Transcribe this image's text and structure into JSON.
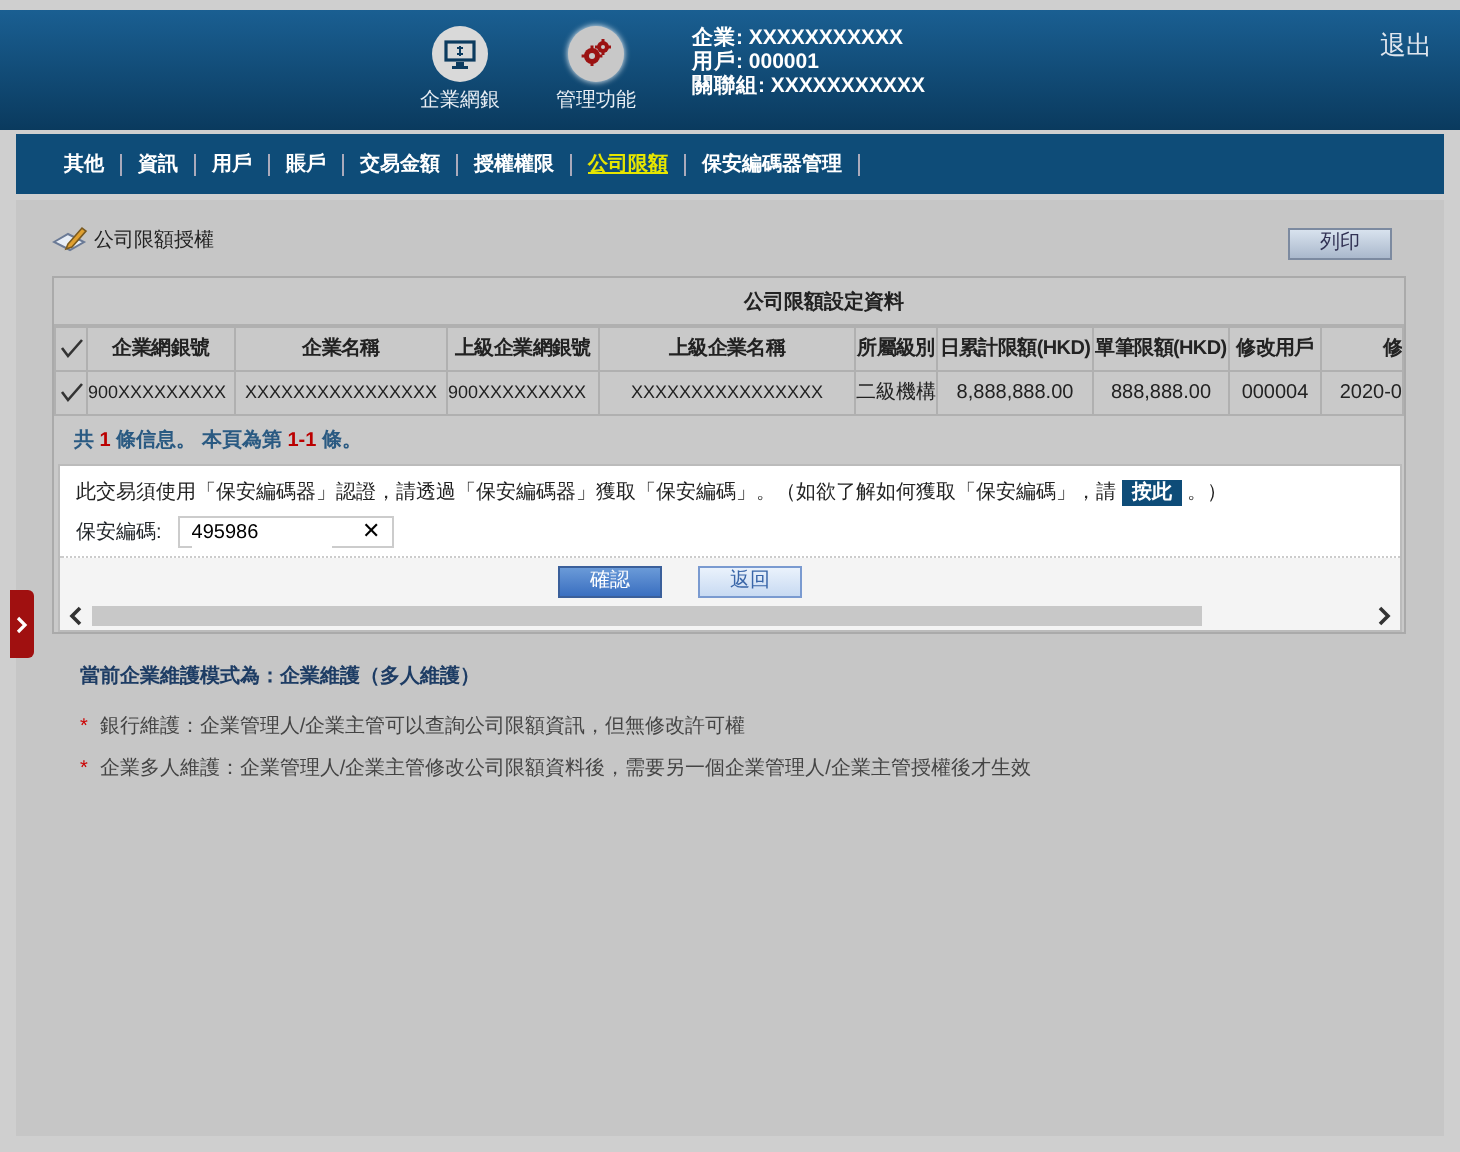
{
  "header": {
    "modules": [
      {
        "label": "企業網銀",
        "selected": false
      },
      {
        "label": "管理功能",
        "selected": true
      }
    ],
    "info": [
      "企業: XXXXXXXXXXX",
      "用戶: 000001",
      "關聯組: XXXXXXXXXXX"
    ],
    "logout": "退出"
  },
  "nav": [
    {
      "label": "其他",
      "selected": false
    },
    {
      "label": "資訊",
      "selected": false
    },
    {
      "label": "用戶",
      "selected": false
    },
    {
      "label": "賬戶",
      "selected": false
    },
    {
      "label": "交易金額",
      "selected": false
    },
    {
      "label": "授權權限",
      "selected": false
    },
    {
      "label": "公司限額",
      "selected": true
    },
    {
      "label": "保安編碼器管理",
      "selected": false
    }
  ],
  "page": {
    "title": "公司限額授權",
    "print_button": "列印"
  },
  "table": {
    "caption": "公司限額設定資料",
    "columns": [
      "企業網銀號",
      "企業名稱",
      "上級企業網銀號",
      "上級企業名稱",
      "所屬級別",
      "日累計限額(HKD)",
      "單筆限額(HKD)",
      "修改用戶",
      "修"
    ],
    "header_checked": true,
    "rows": [
      {
        "checked": true,
        "cells": [
          "900XXXXXXXXX",
          "XXXXXXXXXXXXXXXX",
          "900XXXXXXXXX",
          "XXXXXXXXXXXXXXXX",
          "二級機構",
          "8,888,888.00",
          "888,888.00",
          "000004",
          "2020-0"
        ]
      }
    ],
    "summary": [
      {
        "text": "共 ",
        "highlight": false
      },
      {
        "text": "1",
        "highlight": true
      },
      {
        "text": " 條信息。 本頁為第 ",
        "highlight": false
      },
      {
        "text": "1-1",
        "highlight": true
      },
      {
        "text": " 條。",
        "highlight": false
      }
    ]
  },
  "dialog": {
    "message_before": "此交易須使用「保安編碼器」認證，請透過「保安編碼器」獲取「保安編碼」。（如欲了解如何獲取「保安編碼」，請",
    "link": "按此",
    "message_after": "。）",
    "field_label": "保安編碼:",
    "field_value": "495986",
    "clear": "✕",
    "buttons": [
      {
        "label": "確認",
        "kind": "primary"
      },
      {
        "label": "返回",
        "kind": "secondary"
      }
    ]
  },
  "notes": {
    "heading": "當前企業維護模式為：企業維護（多人維護）",
    "items": [
      {
        "marker": "*",
        "text": "銀行維護：企業管理人/企業主管可以查詢公司限額資訊，但無修改許可權"
      },
      {
        "marker": "*",
        "text": "企業多人維護：企業管理人/企業主管修改公司限額資料後，需要另一個企業管理人/企業主管授權後才生效"
      }
    ]
  }
}
